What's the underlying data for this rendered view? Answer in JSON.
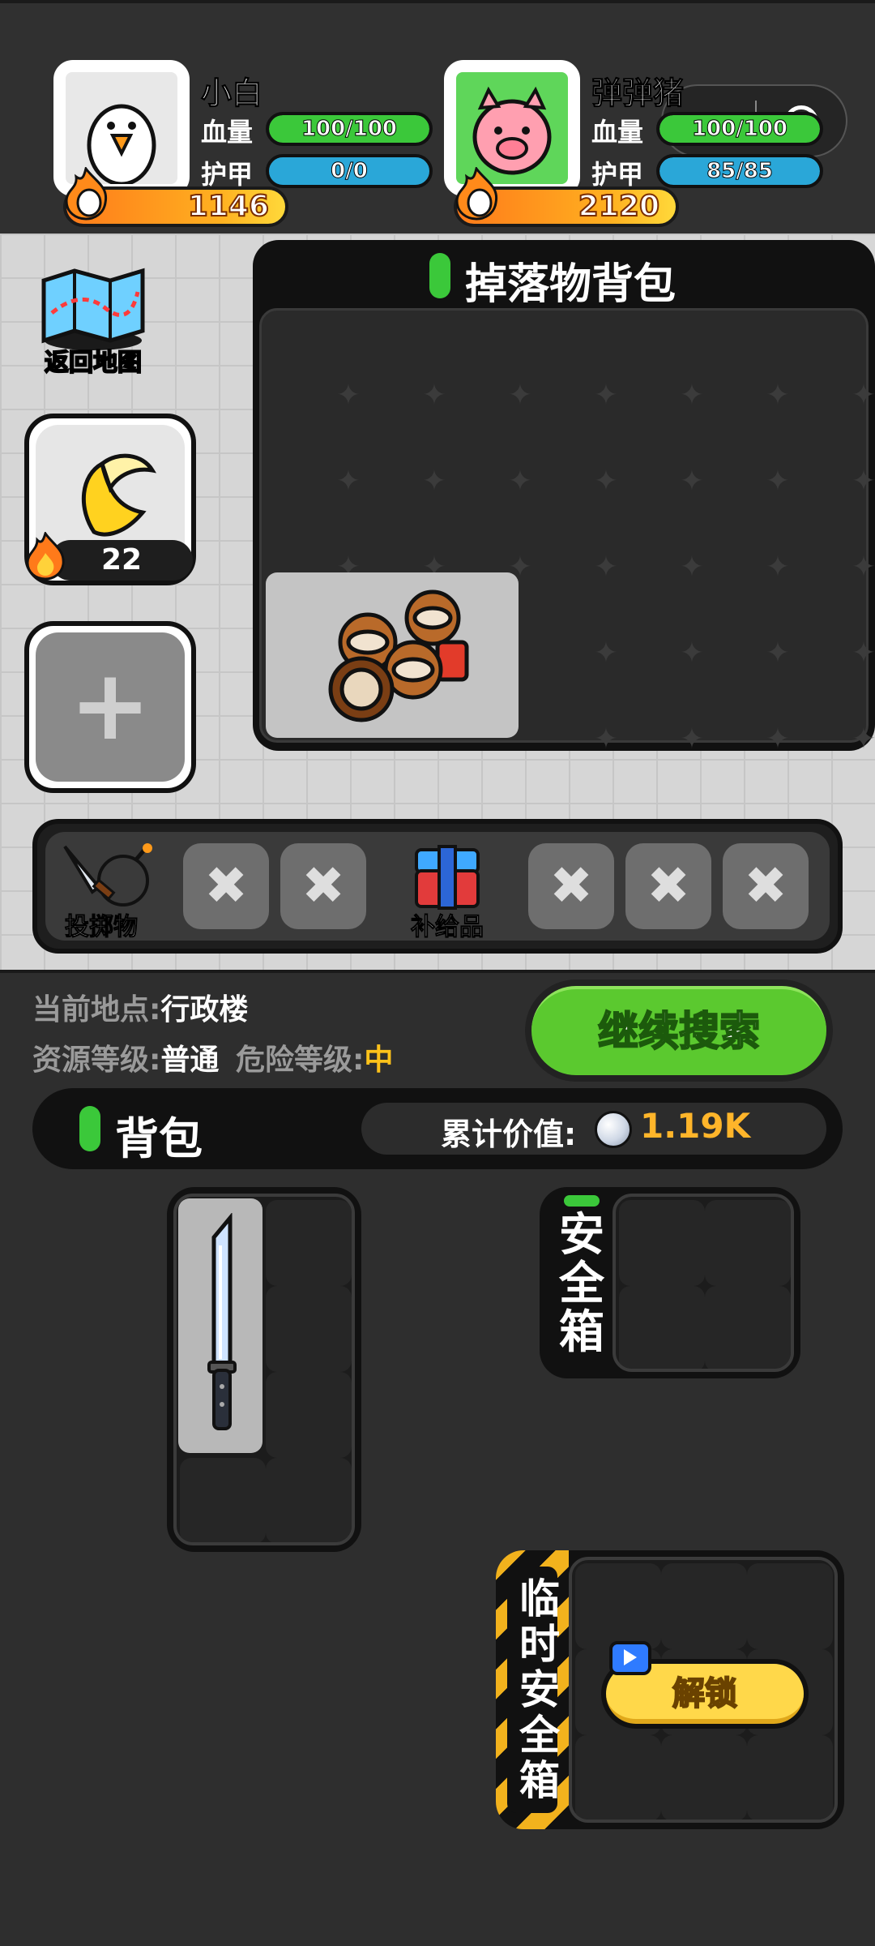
{
  "player1": {
    "name": "小白",
    "hp_label": "血量",
    "hp_text": "100/100",
    "hp_fraction": 1.0,
    "armor_label": "护甲",
    "armor_text": "0/0",
    "armor_fraction": 0.0,
    "power": "1146"
  },
  "player2": {
    "name": "弹弹猪",
    "hp_label": "血量",
    "hp_text": "100/100",
    "hp_fraction": 1.0,
    "armor_label": "护甲",
    "armor_text": "85/85",
    "armor_fraction": 1.0,
    "power": "2120"
  },
  "side": {
    "map_label": "返回地图",
    "banana_count": "22",
    "add_symbol": "+"
  },
  "loot": {
    "title": "掉落物背包"
  },
  "quickbar": {
    "throwables_label": "投掷物",
    "supplies_label": "补给品",
    "x_symbol": "✖"
  },
  "location": {
    "label": "当前地点:",
    "value": "行政楼"
  },
  "resource": {
    "label": "资源等级:",
    "value": "普通"
  },
  "danger": {
    "label": "危险等级:",
    "value": "中"
  },
  "search_button": "继续搜索",
  "bag": {
    "title": "背包",
    "value_label": "累计价值:",
    "value": "1.19K"
  },
  "safe_box": {
    "chars": [
      "安",
      "全",
      "箱"
    ]
  },
  "temp_safe_box": {
    "chars": [
      "临",
      "时",
      "安",
      "全",
      "箱"
    ],
    "unlock_label": "解锁"
  },
  "colors": {
    "hp": "#3bc83a",
    "armor": "#2aa7d8",
    "accent_green": "#5bc92f",
    "gold": "#ffb52a"
  }
}
